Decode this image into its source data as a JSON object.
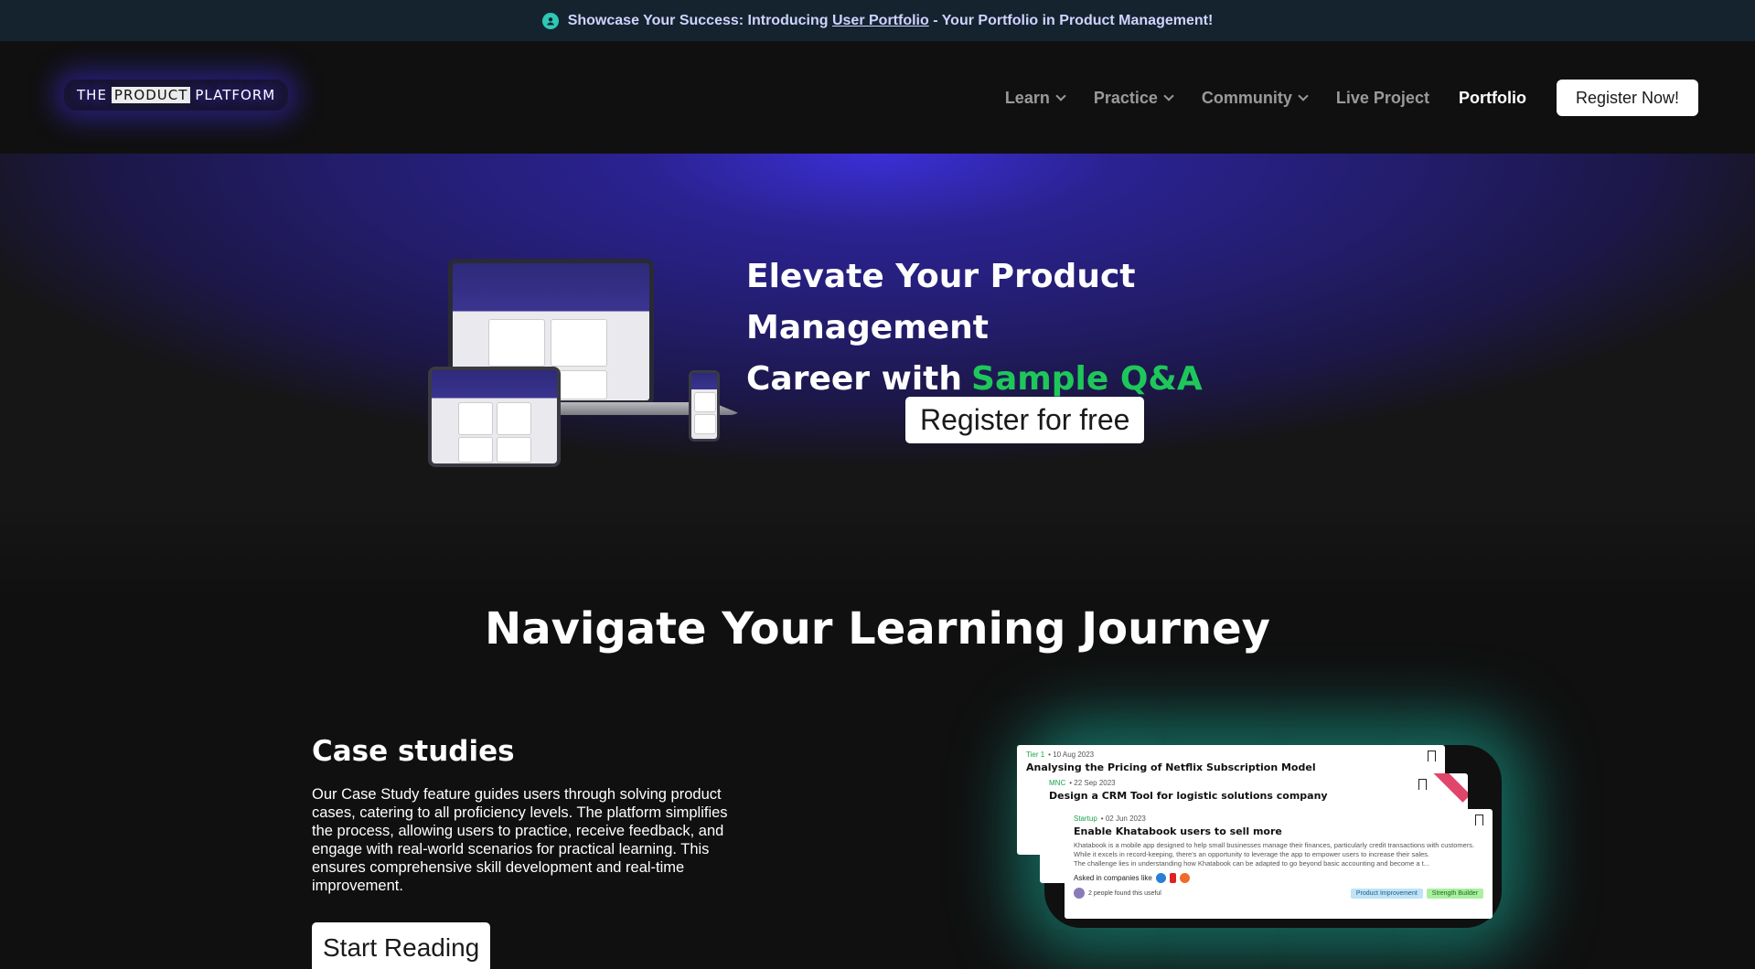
{
  "announcement": {
    "prefix": "Showcase Your Success: Introducing ",
    "link": "User Portfolio",
    "suffix": " - Your Portfolio in Product Management!"
  },
  "logo": {
    "part1": "THE",
    "part2": "PRODUCT",
    "part3": "PLATFORM"
  },
  "nav": {
    "items": [
      {
        "label": "Learn",
        "dropdown": true
      },
      {
        "label": "Practice",
        "dropdown": true
      },
      {
        "label": "Community",
        "dropdown": true
      },
      {
        "label": "Live Project",
        "dropdown": false
      },
      {
        "label": "Portfolio",
        "dropdown": false,
        "active": true
      }
    ],
    "cta": "Register Now!"
  },
  "hero": {
    "title_line1": "Elevate Your Product Management",
    "title_line2": "Career with",
    "title_accent": "Sample Q&A",
    "cta": "Register for free",
    "accent_color": "#1ec75a"
  },
  "journey": {
    "title": "Navigate Your Learning Journey",
    "case_studies": {
      "title": "Case studies",
      "description": "Our Case Study feature guides users through solving product cases, catering to all proficiency levels. The platform simplifies the process, allowing users to practice, receive feedback, and engage with real-world scenarios for practical learning. This ensures comprehensive skill development and real-time improvement.",
      "cta": "Start Reading"
    },
    "cards": [
      {
        "tag": "Tier 1",
        "date": "10 Aug 2023",
        "title": "Analysing the Pricing of Netflix Subscription Model"
      },
      {
        "tag": "MNC",
        "date": "22 Sep 2023",
        "title": "Design a CRM Tool for logistic solutions company"
      },
      {
        "tag": "Startup",
        "date": "02 Jun 2023",
        "title": "Enable Khatabook users to sell more",
        "body1": "Khatabook is a mobile app designed to help small businesses manage their finances, particularly credit transactions with customers. While it excels in record-keeping, there's an opportunity to leverage the app to empower users to increase their sales.",
        "body2": "The challenge lies in understanding how Khatabook can be adapted to go beyond basic accounting and become a t...",
        "asked": "Asked in companies like",
        "found": "2 people found this useful",
        "tags": [
          "Product Improvement",
          "Strength Builder"
        ]
      }
    ]
  },
  "colors": {
    "background": "#101010",
    "announcement_bg": "#15232f",
    "hero_glow": "#3b2fd6",
    "teal_glow": "#1ab4a0"
  }
}
